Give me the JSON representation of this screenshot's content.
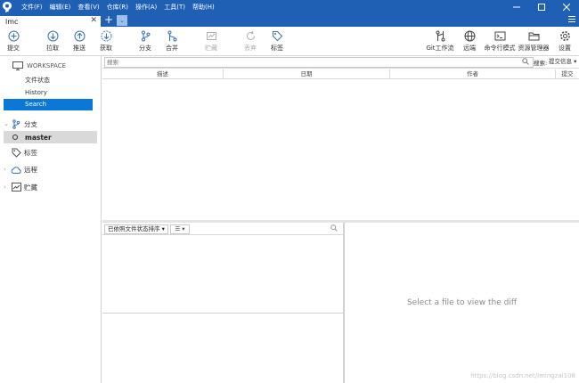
{
  "titlebar": {
    "menus": [
      "文件(F)",
      "编辑(E)",
      "查看(V)",
      "仓库(R)",
      "操作(A)",
      "工具(T)",
      "帮助(H)"
    ],
    "logo_icon": "sourcetree-logo-icon",
    "accent": "#1f5fb4"
  },
  "tabs": {
    "active_tab": "lmc",
    "close": "✕",
    "add": "+",
    "dropdown": "⌄"
  },
  "toolbar": {
    "left": [
      {
        "label": "提交",
        "icon": "plus-circle-icon",
        "enabled": true
      },
      {
        "label": "拉取",
        "icon": "arrow-down-circle-icon",
        "enabled": true
      },
      {
        "label": "推送",
        "icon": "arrow-up-circle-icon",
        "enabled": true
      },
      {
        "label": "获取",
        "icon": "fetch-icon",
        "enabled": true
      },
      {
        "label": "分支",
        "icon": "branch-icon",
        "enabled": true
      },
      {
        "label": "合并",
        "icon": "merge-icon",
        "enabled": true
      },
      {
        "label": "贮藏",
        "icon": "stash-icon",
        "enabled": false
      },
      {
        "label": "丢弃",
        "icon": "discard-icon",
        "enabled": false
      },
      {
        "label": "标签",
        "icon": "tag-icon",
        "enabled": true
      }
    ],
    "right": [
      {
        "label": "Git工作流",
        "icon": "git-flow-icon"
      },
      {
        "label": "远端",
        "icon": "globe-icon"
      },
      {
        "label": "命令行模式",
        "icon": "terminal-icon"
      },
      {
        "label": "资源管理器",
        "icon": "folder-icon"
      },
      {
        "label": "设置",
        "icon": "gear-icon"
      }
    ]
  },
  "sidebar": {
    "workspace": "WORKSPACE",
    "workspace_items": [
      {
        "label": "文件状态",
        "active": false
      },
      {
        "label": "History",
        "active": false
      },
      {
        "label": "Search",
        "active": true
      }
    ],
    "sections": {
      "branches": "分支",
      "current_branch": "master",
      "tags": "标签",
      "remotes": "远程",
      "stashes": "贮藏"
    }
  },
  "search": {
    "placeholder": "搜索",
    "label": "搜索:",
    "mode": "提交信息",
    "mode_caret": "▾"
  },
  "columns": [
    "描述",
    "日期",
    "作者",
    "提交"
  ],
  "files": {
    "sort_label": "已依照文件状态排序",
    "view_label": "☰"
  },
  "diff": {
    "placeholder": "Select a file to view the diff"
  },
  "watermark": "https://blog.csdn.net/lmingzai108"
}
